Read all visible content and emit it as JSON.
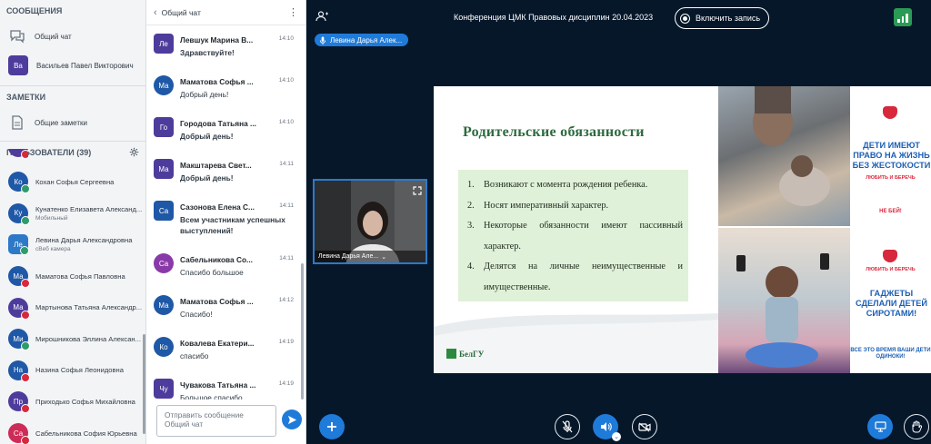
{
  "sidebar": {
    "messages_title": "СООБЩЕНИЯ",
    "chat_item": "Общий чат",
    "private_chat": {
      "initials": "Ва",
      "name": "Васильев Павел Викторович"
    },
    "notes_title": "ЗАМЕТКИ",
    "notes_item": "Общие заметки",
    "users_title": "ПОЛЬЗОВАТЕЛИ (39)",
    "users": [
      {
        "initials": "Ко",
        "name": "Кохан Софья Сергеевна",
        "sub": ""
      },
      {
        "initials": "Ку",
        "name": "Кунатенко Елизавета Александ...",
        "sub": "Мобильный"
      },
      {
        "initials": "Ле",
        "name": "Левина Дарья Александровна",
        "sub": "сВеб камера"
      },
      {
        "initials": "Ма",
        "name": "Маматова Софья Павловна",
        "sub": ""
      },
      {
        "initials": "Ма",
        "name": "Мартынова Татьяна Александр...",
        "sub": ""
      },
      {
        "initials": "Ми",
        "name": "Мирошникова Эллина Алексан...",
        "sub": ""
      },
      {
        "initials": "На",
        "name": "Назина Софья Леонидовна",
        "sub": ""
      },
      {
        "initials": "Пр",
        "name": "Приходько Софья Михайловна",
        "sub": ""
      },
      {
        "initials": "Са",
        "name": "Сабельникова София Юрьевна",
        "sub": ""
      }
    ]
  },
  "chat": {
    "title": "Общий чат",
    "messages": [
      {
        "initials": "Ле",
        "name": "Левшук Марина В...",
        "time": "14:10",
        "text": "Здравствуйте!",
        "bold": true
      },
      {
        "initials": "Ма",
        "name": "Маматова Софья ...",
        "time": "14:10",
        "text": "Добрый день!",
        "bold": false
      },
      {
        "initials": "Го",
        "name": "Городова Татьяна ...",
        "time": "14:10",
        "text": "Добрый день!",
        "bold": true
      },
      {
        "initials": "Ма",
        "name": "Макштарева Свет...",
        "time": "14:11",
        "text": "Добрый день!",
        "bold": true
      },
      {
        "initials": "Са",
        "name": "Сазонова Елена С...",
        "time": "14:11",
        "text": "Всем участникам успешных выступлений!",
        "bold": true
      },
      {
        "initials": "Са",
        "name": "Сабельникова Со...",
        "time": "14:11",
        "text": "Спасибо большое",
        "bold": false
      },
      {
        "initials": "Ма",
        "name": "Маматова Софья ...",
        "time": "14:12",
        "text": "Спасибо!",
        "bold": false
      },
      {
        "initials": "Ко",
        "name": "Ковалева Екатери...",
        "time": "14:19",
        "text": "спасибо",
        "bold": false
      },
      {
        "initials": "Чу",
        "name": "Чувакова Татьяна ...",
        "time": "14:19",
        "text": "Большое спасибо",
        "bold": false
      }
    ],
    "composer_placeholder": "Отправить сообщение Общий чат"
  },
  "main": {
    "conference_title": "Конференция ЦМК Правовых дисциплин 20.04.2023",
    "record_label": "Включить запись",
    "speaker_label": "Левина Дарья Алек...",
    "video_label": "Левина Дарья Але..."
  },
  "slide": {
    "title": "Родительские обязанности",
    "items": [
      {
        "n": "1.",
        "text": "Возникают с момента рождения ребенка."
      },
      {
        "n": "2.",
        "text": "Носят императивный характер."
      },
      {
        "n": "3.",
        "text": "Некоторые обязанности имеют пассивный характер."
      },
      {
        "n": "4.",
        "text": "Делятся на личные неимущественные и имущественные."
      }
    ],
    "logo_text": "БелГУ",
    "poster": {
      "top_heading": "ДЕТИ ИМЕЮТ ПРАВО НА ЖИЗНЬ БЕЗ ЖЕСТОКОСТИ",
      "top_slogan": "ЛЮБИТЬ И БЕРЕЧЬ",
      "top_cta": "НЕ БЕЙ!",
      "bottom_heading": "ГАДЖЕТЫ СДЕЛАЛИ ДЕТЕЙ СИРОТАМИ!",
      "bottom_slogan": "ЛЮБИТЬ И БЕРЕЧЬ",
      "bottom_cta": "ВСЕ ЭТО ВРЕМЯ ВАШИ ДЕТИ ОДИНОКИ!"
    }
  },
  "colors": {
    "accent": "#1f7bd9",
    "avatar": "#4e3c9c",
    "status_red": "#d7283c",
    "slide_green": "#2c6a3e"
  }
}
